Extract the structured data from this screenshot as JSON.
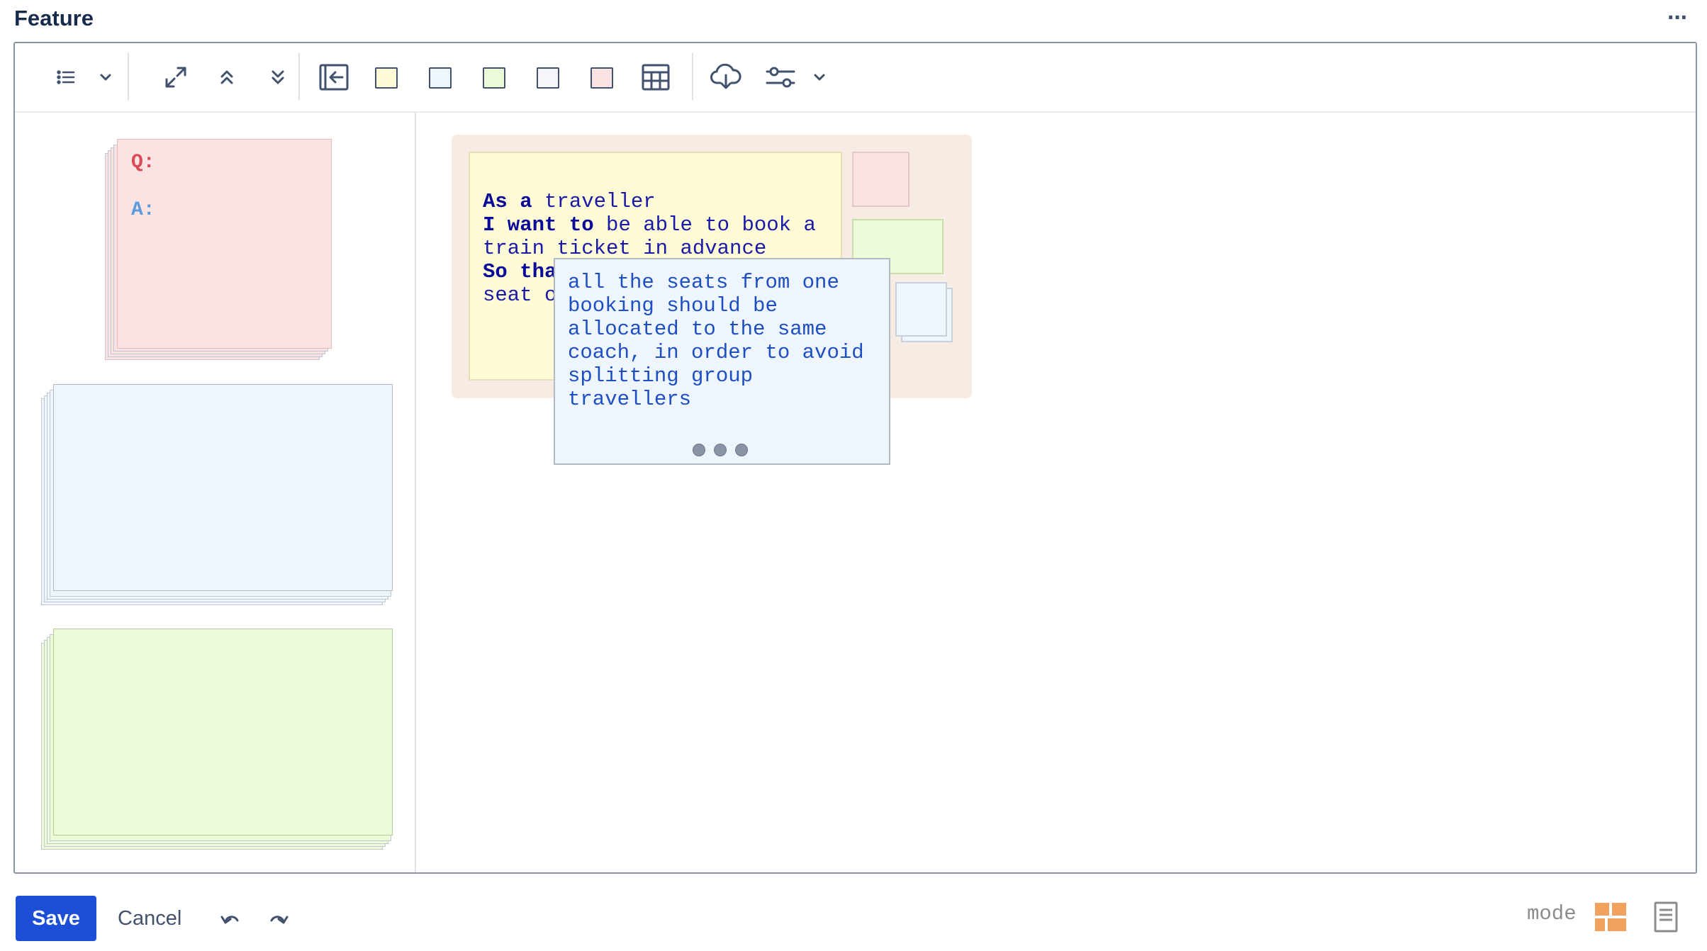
{
  "header": {
    "title": "Feature",
    "more_label": "···"
  },
  "toolbar": {
    "buttons": [
      {
        "name": "list-icon"
      },
      {
        "name": "chevron-down-icon"
      },
      {
        "name": "expand-icon"
      },
      {
        "name": "collapse-up-icon"
      },
      {
        "name": "collapse-down-icon"
      },
      {
        "name": "exit-icon"
      },
      {
        "name": "table-icon"
      },
      {
        "name": "cloud-download-icon"
      },
      {
        "name": "settings-sliders-icon"
      },
      {
        "name": "chevron-down-icon"
      }
    ],
    "swatches": [
      "#fffbd6",
      "#eef5fd",
      "#eefbd9",
      "#f4f6fa",
      "#fbe3e3"
    ]
  },
  "sidebar": {
    "question_card": {
      "q_label": "Q:",
      "a_label": "A:",
      "q_color": "#d94a55",
      "a_color": "#5b9bdc",
      "bg": "#fbe3e3"
    },
    "rule_stack": {
      "bg": "#eef5fd"
    },
    "example_stack": {
      "bg": "#eefbd9"
    }
  },
  "story": {
    "line1_kw": "As a",
    "line1_rest": " traveller",
    "line2_kw": "I want to",
    "line2_rest": " be able to book a",
    "line3": "train ticket in advance",
    "line4_kw": "So that",
    "line5": "seat on"
  },
  "rule_card": {
    "text": "all the seats from one\nbooking should be\nallocated to the same\ncoach, in order to avoid\nsplitting group\ntravellers"
  },
  "footer": {
    "save_label": "Save",
    "cancel_label": "Cancel",
    "mode_label": "mode"
  },
  "colors": {
    "accent": "#1d4ed8",
    "mode_active": "#f0a15e"
  }
}
